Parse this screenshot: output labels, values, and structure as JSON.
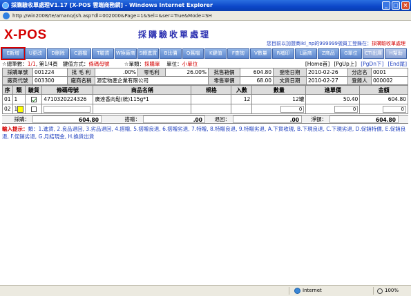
{
  "window": {
    "title": "採購驗收單處理V1.17 [X-POS 雲端商務網] - Windows Internet Explorer",
    "address": "http://win2008/te/amano/jsh.asp?dl=002000&Page=1&Sel=&ser=True&Mode=SH"
  },
  "header": {
    "logo": "X-POS",
    "page_title": "採購驗收單處理",
    "notice_pre": "您目前以加盟商ikl_np的999999號員工登錄在：",
    "notice_loc": "採購驗收單處理"
  },
  "toolbar": [
    "E新增",
    "U更改",
    "D刪除",
    "C選檔",
    "T驗貨",
    "W換廠商",
    "S轉進貨",
    "B比價",
    "Q舊檔",
    "K鍵值",
    "F查詢",
    "V數量",
    "R補印",
    "L廠商",
    "Z商品",
    "G單位",
    "CTI出庫",
    "H幫助"
  ],
  "summary": {
    "total_label": "☆總筆數：",
    "total": "1/1",
    "page": "第1/4頁",
    "key_label": "鍵值方式：",
    "key_mode": "條碼母號",
    "doc_label": "☆單類：",
    "doc_type": "採購單",
    "unit_label": "單位：",
    "unit": "小單位"
  },
  "nav": {
    "home": "[Home首]",
    "pgup": "[PgUp上]",
    "pgdn": "[PgDn下]",
    "end": "[End尾]"
  },
  "info": {
    "row1": [
      {
        "l": "採購單號",
        "v": "001224"
      },
      {
        "l": "批 毛 利",
        "v": ".00%"
      },
      {
        "l": "零毛利",
        "v": "26.00%"
      },
      {
        "l": "批售箱價",
        "v": "604.80"
      },
      {
        "l": "登陸日期",
        "v": "2010-02-26"
      },
      {
        "l": "分店名",
        "v": "0001"
      }
    ],
    "row2": [
      {
        "l": "廠商代號",
        "v": "003300"
      },
      {
        "l": "廠商名稱",
        "v": "源宏物產企業有限公司"
      },
      {
        "l": "零售單價",
        "v": "68.00"
      },
      {
        "l": "文貨日期",
        "v": "2010-02-27"
      },
      {
        "l": "登錄人",
        "v": "000002"
      }
    ]
  },
  "grid": {
    "headers": [
      "序",
      "類",
      "驗貨",
      "條碼母號",
      "商品名稱",
      "規格",
      "入數",
      "數量",
      "進單價",
      "金額"
    ],
    "row": {
      "seq": "01",
      "cls": "1",
      "barcode": "4710320224326",
      "name": "廣達香肉鬆(統)115g*1",
      "spec": "",
      "qty_in": "12",
      "qty": "12罐",
      "price": "50.40",
      "amount": "604.80"
    },
    "new_row": {
      "seq": "02",
      "cls": "1",
      "qty": "0",
      "price": "0",
      "amount": "0"
    }
  },
  "totals": {
    "purchase_label": "採購：",
    "purchase": "604.80",
    "gift_label": "搭贈：",
    "gift": ".00",
    "return_label": "退回：",
    "return": ".00",
    "net_label": "淨額：",
    "net": "604.80"
  },
  "hint": {
    "label": "輸入提示：",
    "text": "類：1.進貨, 2.良品退回, 3.劣品退回, 4.搭贈, 5.搭贈良退, 6.搭贈劣退, 7.特贈, 8.特贈良退, 9.特贈劣退, A.下貨收現, B.下現良退, C.下現劣退, D.促銷特價, E.促銷良退, F.促銷劣退, G.月結現金, H.換貨出貨"
  },
  "status": {
    "zone": "Internet",
    "zoom": "100%"
  }
}
